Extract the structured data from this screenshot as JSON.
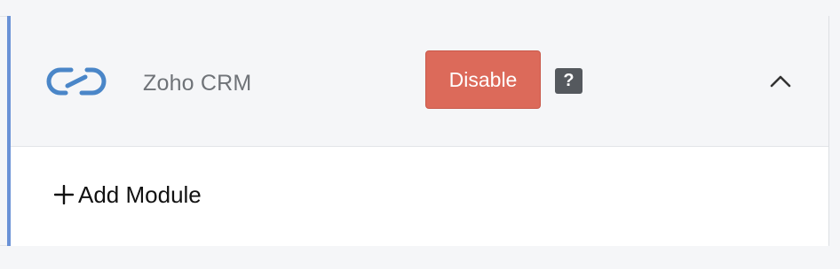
{
  "integration": {
    "name": "Zoho CRM",
    "logo_icon": "zoho-link-icon",
    "disable_label": "Disable",
    "help_label": "?",
    "collapse_icon": "chevron-up-icon",
    "expanded": true
  },
  "modules": {
    "add_label": "Add Module",
    "add_icon": "plus-icon"
  },
  "colors": {
    "accent": "#6a92d6",
    "disable_bg": "#dc6a5a",
    "help_bg": "#55595e",
    "logo": "#4a86c8"
  }
}
